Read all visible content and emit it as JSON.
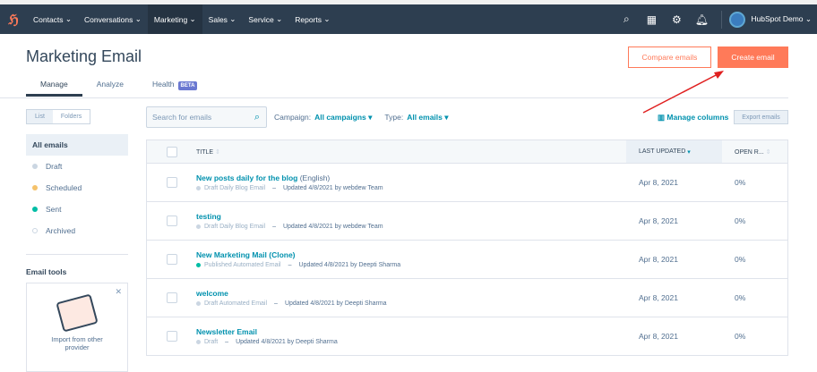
{
  "nav": {
    "items": [
      "Contacts",
      "Conversations",
      "Marketing",
      "Sales",
      "Service",
      "Reports"
    ],
    "active": "Marketing",
    "user": "HubSpot Demo"
  },
  "page": {
    "title": "Marketing Email",
    "compare_label": "Compare emails",
    "create_label": "Create email"
  },
  "tabs": [
    {
      "label": "Manage"
    },
    {
      "label": "Analyze"
    },
    {
      "label": "Health",
      "badge": "BETA"
    }
  ],
  "sidebar": {
    "toggle": [
      "List",
      "Folders"
    ],
    "items": [
      {
        "label": "All emails"
      },
      {
        "label": "Draft",
        "color": "#cbd6e2"
      },
      {
        "label": "Scheduled",
        "color": "#f5c26b"
      },
      {
        "label": "Sent",
        "color": "#00bda5"
      },
      {
        "label": "Archived",
        "color": "#ffffff"
      }
    ],
    "tools_heading": "Email tools",
    "tools_card": "Import from other provider"
  },
  "filters": {
    "search_placeholder": "Search for emails",
    "campaign_label": "Campaign:",
    "campaign_value": "All campaigns",
    "type_label": "Type:",
    "type_value": "All emails",
    "manage_columns": "Manage columns",
    "export": "Export emails"
  },
  "table": {
    "headers": {
      "title": "TITLE",
      "updated": "LAST UPDATED",
      "open": "OPEN R..."
    },
    "rows": [
      {
        "title": "New posts daily for the blog",
        "lang": "(English)",
        "status": "Draft Daily Blog Email",
        "updated_by": "Updated 4/8/2021 by webdew Team",
        "date": "Apr 8, 2021",
        "open": "0%",
        "color": "#cbd6e2"
      },
      {
        "title": "testing",
        "lang": "",
        "status": "Draft Daily Blog Email",
        "updated_by": "Updated 4/8/2021 by webdew Team",
        "date": "Apr 8, 2021",
        "open": "0%",
        "color": "#cbd6e2"
      },
      {
        "title": "New Marketing Mail (Clone)",
        "lang": "",
        "status": "Published Automated Email",
        "updated_by": "Updated 4/8/2021 by Deepti Sharma",
        "date": "Apr 8, 2021",
        "open": "0%",
        "color": "#00bda5"
      },
      {
        "title": "welcome",
        "lang": "",
        "status": "Draft Automated Email",
        "updated_by": "Updated 4/8/2021 by Deepti Sharma",
        "date": "Apr 8, 2021",
        "open": "0%",
        "color": "#cbd6e2"
      },
      {
        "title": "Newsletter Email",
        "lang": "",
        "status": "Draft",
        "updated_by": "Updated 4/8/2021 by Deepti Sharma",
        "date": "Apr 8, 2021",
        "open": "0%",
        "color": "#cbd6e2"
      }
    ]
  }
}
